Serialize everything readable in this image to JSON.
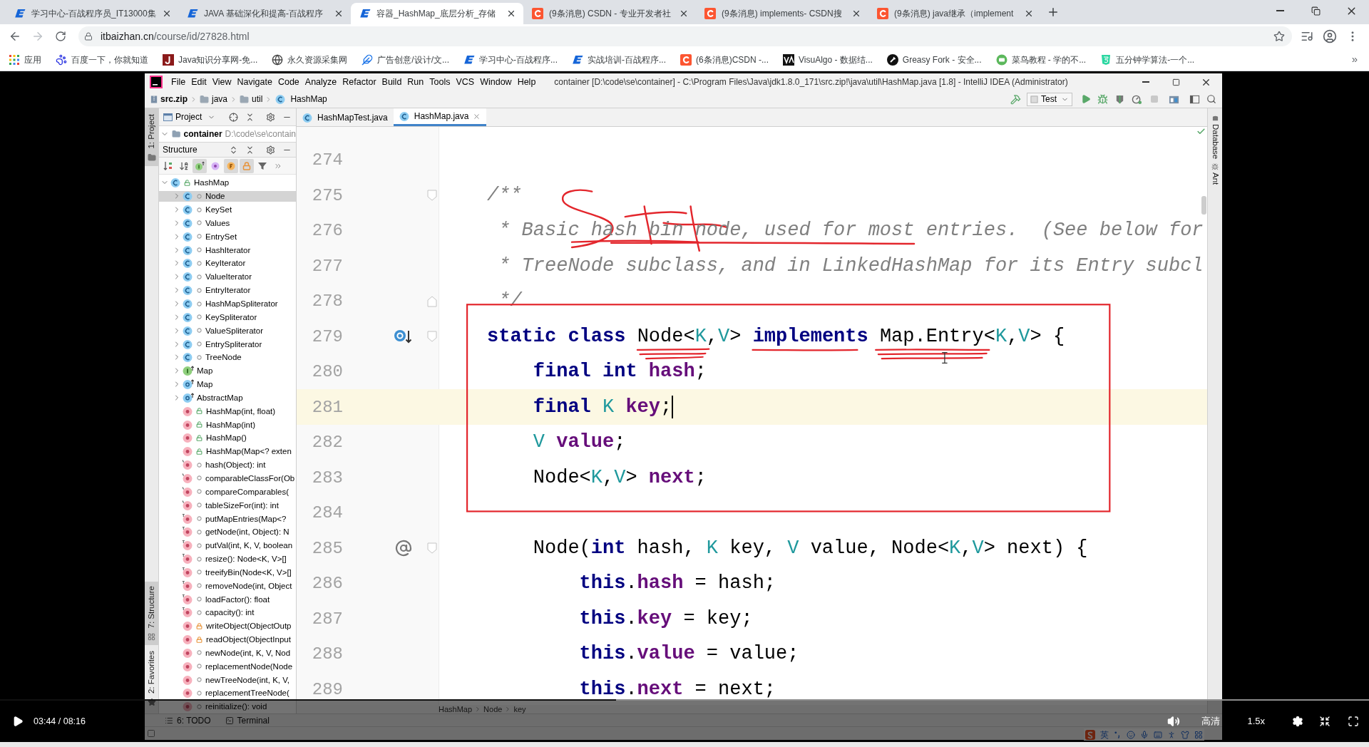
{
  "browser": {
    "tabs": [
      {
        "title": "学习中心-百战程序员_IT13000集",
        "kind": "baizhan",
        "selected": false
      },
      {
        "title": "JAVA 基础深化和提高-百战程序",
        "kind": "baizhan",
        "selected": false
      },
      {
        "title": "容器_HashMap_底层分析_存储",
        "kind": "baizhan",
        "selected": true
      },
      {
        "title": "(9条消息) CSDN - 专业开发者社",
        "kind": "csdn",
        "selected": false
      },
      {
        "title": "(9条消息) implements- CSDN搜",
        "kind": "csdn",
        "selected": false
      },
      {
        "title": "(9条消息) java继承（implement",
        "kind": "csdn",
        "selected": false
      }
    ],
    "address": {
      "host": "itbaizhan.cn",
      "path": "/course/id/27828.html"
    },
    "bookmarks": [
      {
        "label": "应用",
        "kind": "apps"
      },
      {
        "label": "百度一下，你就知道",
        "kind": "paw"
      },
      {
        "label": "Java知识分享网-免...",
        "kind": "letter"
      },
      {
        "label": "永久资源采集网",
        "kind": "globe"
      },
      {
        "label": "广告创意/设计/文...",
        "kind": "feather"
      },
      {
        "label": "学习中心-百战程序...",
        "kind": "baizhan"
      },
      {
        "label": "实战培训-百战程序...",
        "kind": "baizhan"
      },
      {
        "label": "(6条消息)CSDN -...",
        "kind": "csdn"
      },
      {
        "label": "VisuAlgo - 数据结...",
        "kind": "va"
      },
      {
        "label": "Greasy Fork - 安全...",
        "kind": "fork"
      },
      {
        "label": "菜鸟教程 - 学的不...",
        "kind": "bird"
      },
      {
        "label": "五分钟学算法-一个...",
        "kind": "html5"
      }
    ],
    "more": "»"
  },
  "ide": {
    "menu": [
      "File",
      "Edit",
      "View",
      "Navigate",
      "Code",
      "Analyze",
      "Refactor",
      "Build",
      "Run",
      "Tools",
      "VCS",
      "Window",
      "Help"
    ],
    "title": "container [D:\\code\\se\\container] - C:\\Program Files\\Java\\jdk1.8.0_171\\src.zip!\\java\\util\\HashMap.java [1.8] - IntelliJ IDEA (Administrator)",
    "breadcrumb": [
      {
        "label": "src.zip",
        "kind": "archive"
      },
      {
        "label": "java",
        "kind": "folder"
      },
      {
        "label": "util",
        "kind": "folder"
      },
      {
        "label": "HashMap",
        "kind": "class"
      }
    ],
    "run_config": "Test",
    "left_tools_top": [
      {
        "label": "1: Project",
        "selected": true
      }
    ],
    "left_tools_bottom": [
      {
        "label": "7: Structure",
        "kind": "structure",
        "selected": true
      },
      {
        "label": "2: Favorites",
        "kind": "favorites",
        "selected": false
      }
    ],
    "project": {
      "title": "Project",
      "root": {
        "label": "container",
        "path": "D:\\code\\se\\contain",
        "expanded": true
      }
    },
    "structure": {
      "title": "Structure",
      "toolbar": [
        {
          "kind": "sort-visibility",
          "on": false
        },
        {
          "kind": "sort-alpha",
          "on": false
        },
        {
          "kind": "inherited",
          "on": true
        },
        {
          "kind": "properties",
          "on": false
        },
        {
          "kind": "fields",
          "on": true
        },
        {
          "kind": "non-public",
          "on": true
        },
        {
          "kind": "filter",
          "on": false
        },
        {
          "kind": "more"
        }
      ],
      "tree": [
        {
          "label": "HashMap",
          "kind": "public-class",
          "expanded": true,
          "selected": false,
          "children": [
            {
              "label": "Node",
              "kind": "package-class",
              "expanded": false,
              "selected": true
            },
            {
              "label": "KeySet",
              "kind": "package-class",
              "expanded": false,
              "selected": false
            },
            {
              "label": "Values",
              "kind": "package-class",
              "expanded": false,
              "selected": false
            },
            {
              "label": "EntrySet",
              "kind": "package-class",
              "expanded": false,
              "selected": false
            },
            {
              "label": "HashIterator",
              "kind": "package-class",
              "expanded": false,
              "selected": false
            },
            {
              "label": "KeyIterator",
              "kind": "package-class",
              "expanded": false,
              "selected": false
            },
            {
              "label": "ValueIterator",
              "kind": "package-class",
              "expanded": false,
              "selected": false
            },
            {
              "label": "EntryIterator",
              "kind": "package-class",
              "expanded": false,
              "selected": false
            },
            {
              "label": "HashMapSpliterator",
              "kind": "package-class",
              "expanded": false,
              "selected": false
            },
            {
              "label": "KeySpliterator",
              "kind": "package-class",
              "expanded": false,
              "selected": false
            },
            {
              "label": "ValueSpliterator",
              "kind": "package-class",
              "expanded": false,
              "selected": false
            },
            {
              "label": "EntrySpliterator",
              "kind": "package-class",
              "expanded": false,
              "selected": false
            },
            {
              "label": "TreeNode",
              "kind": "package-class",
              "expanded": false,
              "selected": false
            },
            {
              "label": "Map",
              "kind": "inherited-interface",
              "expanded": false,
              "selected": false
            },
            {
              "label": "Map",
              "kind": "inherited-abstract",
              "expanded": false,
              "selected": false
            },
            {
              "label": "AbstractMap",
              "kind": "inherited-abstract",
              "expanded": false,
              "selected": false
            },
            {
              "label": "HashMap(int, float)",
              "kind": "public-method",
              "selected": false
            },
            {
              "label": "HashMap(int)",
              "kind": "public-method",
              "selected": false
            },
            {
              "label": "HashMap()",
              "kind": "public-method",
              "selected": false
            },
            {
              "label": "HashMap(Map<? exten",
              "kind": "public-method",
              "selected": false
            },
            {
              "label": "hash(Object): int",
              "kind": "static-method",
              "selected": false
            },
            {
              "label": "comparableClassFor(Ob",
              "kind": "static-method",
              "selected": false
            },
            {
              "label": "compareComparables(",
              "kind": "static-method",
              "selected": false
            },
            {
              "label": "tableSizeFor(int): int",
              "kind": "static-method",
              "selected": false
            },
            {
              "label": "putMapEntries(Map<?",
              "kind": "final-method",
              "selected": false
            },
            {
              "label": "getNode(int, Object): N",
              "kind": "final-method",
              "selected": false
            },
            {
              "label": "putVal(int, K, V, boolean",
              "kind": "final-method",
              "selected": false
            },
            {
              "label": "resize(): Node<K, V>[]",
              "kind": "final-method",
              "selected": false
            },
            {
              "label": "treeifyBin(Node<K, V>[]",
              "kind": "final-method",
              "selected": false
            },
            {
              "label": "removeNode(int, Object",
              "kind": "final-method",
              "selected": false
            },
            {
              "label": "loadFactor(): float",
              "kind": "final-method",
              "selected": false
            },
            {
              "label": "capacity(): int",
              "kind": "final-method",
              "selected": false
            },
            {
              "label": "writeObject(ObjectOutp",
              "kind": "private-method",
              "selected": false
            },
            {
              "label": "readObject(ObjectInput",
              "kind": "private-method",
              "selected": false
            },
            {
              "label": "newNode(int, K, V, Nod",
              "kind": "package-method",
              "selected": false
            },
            {
              "label": "replacementNode(Node",
              "kind": "package-method",
              "selected": false
            },
            {
              "label": "newTreeNode(int, K, V,",
              "kind": "package-method",
              "selected": false
            },
            {
              "label": "replacementTreeNode(",
              "kind": "package-method",
              "selected": false
            },
            {
              "label": "reinitialize(): void",
              "kind": "package-method",
              "selected": false
            }
          ]
        }
      ]
    },
    "editor": {
      "tabs": [
        {
          "label": "HashMapTest.java",
          "selected": false
        },
        {
          "label": "HashMap.java",
          "selected": true
        }
      ],
      "lines": [
        {
          "number": "274",
          "kind": "plain"
        },
        {
          "number": "275",
          "kind": "fold-start",
          "tokens": [
            {
              "kind": "comment",
              "text": "/**"
            }
          ]
        },
        {
          "number": "276",
          "kind": "plain",
          "tokens": [
            {
              "kind": "comment",
              "text": " * Basic hash bin node, used for most entries.  (See below for"
            }
          ]
        },
        {
          "number": "277",
          "kind": "plain",
          "tokens": [
            {
              "kind": "comment",
              "text": " * TreeNode subclass, and in LinkedHashMap for its Entry subcl"
            }
          ]
        },
        {
          "number": "278",
          "kind": "fold-end",
          "tokens": [
            {
              "kind": "comment",
              "text": " */"
            }
          ]
        },
        {
          "number": "279",
          "kind": "implemented",
          "tokens": [
            {
              "kind": "keyword",
              "text": "static class "
            },
            {
              "kind": "text",
              "text": "Node<"
            },
            {
              "kind": "type",
              "text": "K"
            },
            {
              "kind": "text",
              "text": ","
            },
            {
              "kind": "type",
              "text": "V"
            },
            {
              "kind": "text",
              "text": "> "
            },
            {
              "kind": "keyword",
              "text": "implements"
            },
            {
              "kind": "text",
              "text": " Map.Entry<"
            },
            {
              "kind": "type",
              "text": "K"
            },
            {
              "kind": "text",
              "text": ","
            },
            {
              "kind": "type",
              "text": "V"
            },
            {
              "kind": "text",
              "text": "> {"
            }
          ]
        },
        {
          "number": "280",
          "kind": "plain",
          "tokens": [
            {
              "kind": "keyword",
              "text": "    final int "
            },
            {
              "kind": "field",
              "text": "hash"
            },
            {
              "kind": "text",
              "text": ";"
            }
          ]
        },
        {
          "number": "281",
          "kind": "plain",
          "current": true,
          "tokens": [
            {
              "kind": "keyword",
              "text": "    final "
            },
            {
              "kind": "type",
              "text": "K "
            },
            {
              "kind": "field",
              "text": "key"
            },
            {
              "kind": "text",
              "text": ";"
            }
          ]
        },
        {
          "number": "282",
          "kind": "plain",
          "tokens": [
            {
              "kind": "type",
              "text": "    V "
            },
            {
              "kind": "field",
              "text": "value"
            },
            {
              "kind": "text",
              "text": ";"
            }
          ]
        },
        {
          "number": "283",
          "kind": "plain",
          "tokens": [
            {
              "kind": "text",
              "text": "    Node<"
            },
            {
              "kind": "type",
              "text": "K"
            },
            {
              "kind": "text",
              "text": ","
            },
            {
              "kind": "type",
              "text": "V"
            },
            {
              "kind": "text",
              "text": "> "
            },
            {
              "kind": "field",
              "text": "next"
            },
            {
              "kind": "text",
              "text": ";"
            }
          ]
        },
        {
          "number": "284",
          "kind": "plain"
        },
        {
          "number": "285",
          "kind": "override",
          "tokens": [
            {
              "kind": "text",
              "text": "    Node("
            },
            {
              "kind": "keyword",
              "text": "int"
            },
            {
              "kind": "text",
              "text": " hash, "
            },
            {
              "kind": "type",
              "text": "K"
            },
            {
              "kind": "text",
              "text": " key, "
            },
            {
              "kind": "type",
              "text": "V"
            },
            {
              "kind": "text",
              "text": " value, Node<"
            },
            {
              "kind": "type",
              "text": "K"
            },
            {
              "kind": "text",
              "text": ","
            },
            {
              "kind": "type",
              "text": "V"
            },
            {
              "kind": "text",
              "text": "> next) {"
            }
          ]
        },
        {
          "number": "286",
          "kind": "plain",
          "tokens": [
            {
              "kind": "keyword",
              "text": "        this"
            },
            {
              "kind": "text",
              "text": "."
            },
            {
              "kind": "field",
              "text": "hash"
            },
            {
              "kind": "text",
              "text": " = hash;"
            }
          ]
        },
        {
          "number": "287",
          "kind": "plain",
          "tokens": [
            {
              "kind": "keyword",
              "text": "        this"
            },
            {
              "kind": "text",
              "text": "."
            },
            {
              "kind": "field",
              "text": "key"
            },
            {
              "kind": "text",
              "text": " = key;"
            }
          ]
        },
        {
          "number": "288",
          "kind": "plain",
          "tokens": [
            {
              "kind": "keyword",
              "text": "        this"
            },
            {
              "kind": "text",
              "text": "."
            },
            {
              "kind": "field",
              "text": "value"
            },
            {
              "kind": "text",
              "text": " = value;"
            }
          ]
        },
        {
          "number": "289",
          "kind": "plain",
          "tokens": [
            {
              "kind": "keyword",
              "text": "        this"
            },
            {
              "kind": "text",
              "text": "."
            },
            {
              "kind": "field",
              "text": "next"
            },
            {
              "kind": "text",
              "text": " = next;"
            }
          ]
        }
      ],
      "breadcrumb": [
        "HashMap",
        "Node",
        "key"
      ]
    },
    "right_tools": [
      {
        "label": "Database",
        "kind": "database"
      },
      {
        "label": "Ant",
        "kind": "ant"
      }
    ],
    "bottom_tools": [
      {
        "label": "6: TODO",
        "kind": "todo"
      },
      {
        "label": "Terminal",
        "kind": "terminal"
      }
    ]
  },
  "ime": {
    "mode": "英"
  },
  "player": {
    "time": "03:44 / 08:16",
    "progress": {
      "level": 0.45
    },
    "quality": "高清",
    "speed": "1.5x"
  }
}
